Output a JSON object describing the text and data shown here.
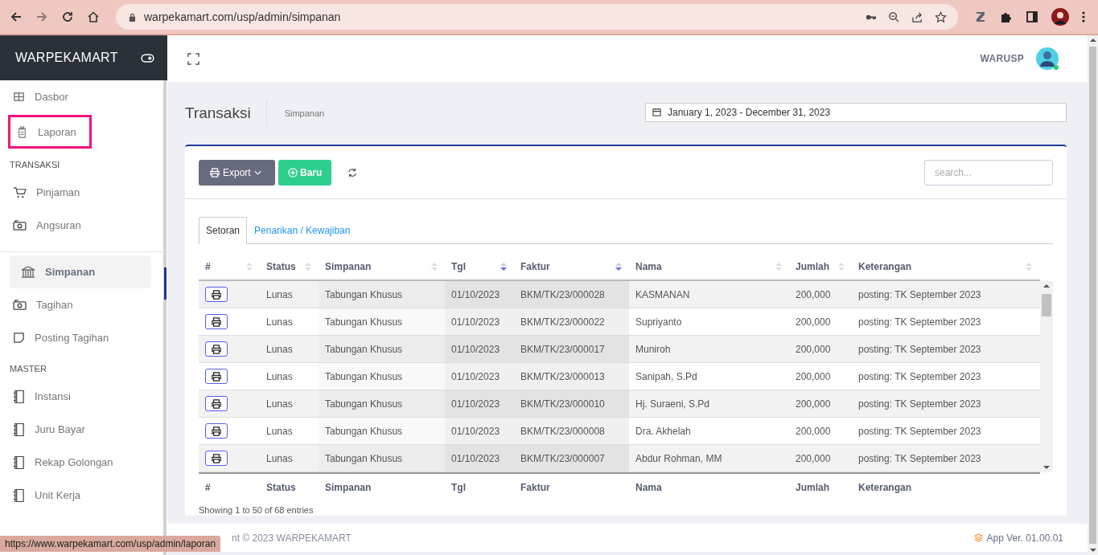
{
  "browser": {
    "url": "warpekamart.com/usp/admin/simpanan",
    "status_url": "https://www.warpekamart.com/usp/admin/laporan"
  },
  "brand": "WARPEKAMART",
  "sidebar": {
    "items": [
      {
        "kind": "item",
        "label": "Dasbor",
        "selected": false,
        "highlighted": false
      },
      {
        "kind": "item",
        "label": "Laporan",
        "selected": false,
        "highlighted": true
      },
      {
        "kind": "section",
        "label": "TRANSAKSI"
      },
      {
        "kind": "item",
        "label": "Pinjaman",
        "selected": false,
        "highlighted": false
      },
      {
        "kind": "item",
        "label": "Angsuran",
        "selected": false,
        "highlighted": false
      },
      {
        "kind": "divider"
      },
      {
        "kind": "item",
        "label": "Simpanan",
        "selected": true,
        "highlighted": false
      },
      {
        "kind": "item",
        "label": "Tagihan",
        "selected": false,
        "highlighted": false
      },
      {
        "kind": "item",
        "label": "Posting Tagihan",
        "selected": false,
        "highlighted": false
      },
      {
        "kind": "section",
        "label": "MASTER"
      },
      {
        "kind": "item",
        "label": "Instansi",
        "selected": false,
        "highlighted": false
      },
      {
        "kind": "item",
        "label": "Juru Bayar",
        "selected": false,
        "highlighted": false
      },
      {
        "kind": "item",
        "label": "Rekap Golongan",
        "selected": false,
        "highlighted": false
      },
      {
        "kind": "item",
        "label": "Unit Kerja",
        "selected": false,
        "highlighted": false
      }
    ]
  },
  "user": "WARUSP",
  "page": {
    "title": "Transaksi",
    "crumb": "Simpanan",
    "date_range": "January 1, 2023 - December 31, 2023"
  },
  "toolbar": {
    "export": "Export",
    "new": "Baru",
    "search_placeholder": "search..."
  },
  "tabs": [
    {
      "label": "Setoran",
      "selected": true
    },
    {
      "label": "Penarikan / Kewajiban",
      "selected": false
    }
  ],
  "table": {
    "columns": [
      {
        "label": "#",
        "sorted": false
      },
      {
        "label": "Status",
        "sorted": false
      },
      {
        "label": "Simpanan",
        "sorted": false
      },
      {
        "label": "Tgl",
        "sorted": true
      },
      {
        "label": "Faktur",
        "sorted": true
      },
      {
        "label": "Nama",
        "sorted": false
      },
      {
        "label": "Jumlah",
        "sorted": false
      },
      {
        "label": "Keterangan",
        "sorted": false
      }
    ],
    "rows": [
      {
        "cells": [
          "",
          "Lunas",
          "Tabungan Khusus",
          "01/10/2023",
          "BKM/TK/23/000028",
          "KASMANAN",
          "200,000",
          "posting: TK September 2023"
        ]
      },
      {
        "cells": [
          "",
          "Lunas",
          "Tabungan Khusus",
          "01/10/2023",
          "BKM/TK/23/000022",
          "Supriyanto",
          "200,000",
          "posting: TK September 2023"
        ]
      },
      {
        "cells": [
          "",
          "Lunas",
          "Tabungan Khusus",
          "01/10/2023",
          "BKM/TK/23/000017",
          "Muniroh",
          "200,000",
          "posting: TK September 2023"
        ]
      },
      {
        "cells": [
          "",
          "Lunas",
          "Tabungan Khusus",
          "01/10/2023",
          "BKM/TK/23/000013",
          "Sanipah, S.Pd",
          "200,000",
          "posting: TK September 2023"
        ]
      },
      {
        "cells": [
          "",
          "Lunas",
          "Tabungan Khusus",
          "01/10/2023",
          "BKM/TK/23/000010",
          "Hj. Suraeni, S.Pd",
          "200,000",
          "posting: TK September 2023"
        ]
      },
      {
        "cells": [
          "",
          "Lunas",
          "Tabungan Khusus",
          "01/10/2023",
          "BKM/TK/23/000008",
          "Dra. Akhelah",
          "200,000",
          "posting: TK September 2023"
        ]
      },
      {
        "cells": [
          "",
          "Lunas",
          "Tabungan Khusus",
          "01/10/2023",
          "BKM/TK/23/000007",
          "Abdur Rohman, MM",
          "200,000",
          "posting: TK September 2023"
        ]
      }
    ],
    "footer_columns": [
      "#",
      "Status",
      "Simpanan",
      "Tgl",
      "Faktur",
      "Nama",
      "Jumlah",
      "Keterangan"
    ],
    "info": "Showing 1 to 50 of 68 entries"
  },
  "footer": {
    "copyright": "nt © 2023 WARPEKAMART",
    "version": "App Ver. 01.00.01"
  }
}
